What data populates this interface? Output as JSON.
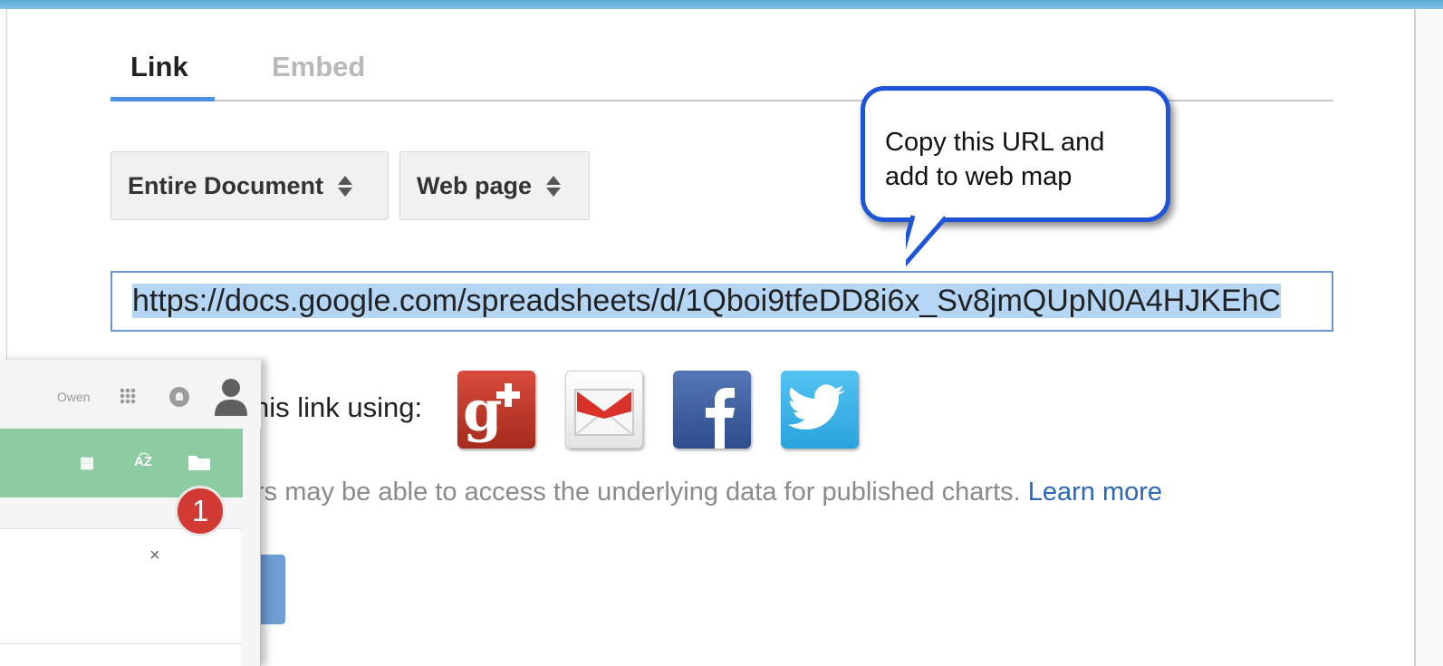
{
  "tabs": {
    "link": "Link",
    "embed": "Embed"
  },
  "selects": {
    "range": "Entire Document",
    "format": "Web page"
  },
  "url": "https://docs.google.com/spreadsheets/d/1Qboi9tfeDD8i6x_Sv8jmQUpN0A4HJKEhC",
  "callout": {
    "text": "Copy this URL and add to web map"
  },
  "share": {
    "label": "his link using:",
    "icons": [
      "google-plus-icon",
      "gmail-icon",
      "facebook-icon",
      "twitter-icon"
    ]
  },
  "note": {
    "text": "rs may be able to access the underlying data for published charts. ",
    "link": "Learn more"
  },
  "inset": {
    "user_name": "Owen",
    "badge_number": "1",
    "close_label": "×",
    "toolbar_icons": [
      "grid-icon",
      "sort-az-icon",
      "folder-icon"
    ]
  },
  "colors": {
    "accent_blue": "#4d90e4",
    "callout_border": "#1e55d8",
    "link_blue": "#2b67b8",
    "inset_green": "#8dcba3",
    "badge_red": "#d23a34"
  }
}
